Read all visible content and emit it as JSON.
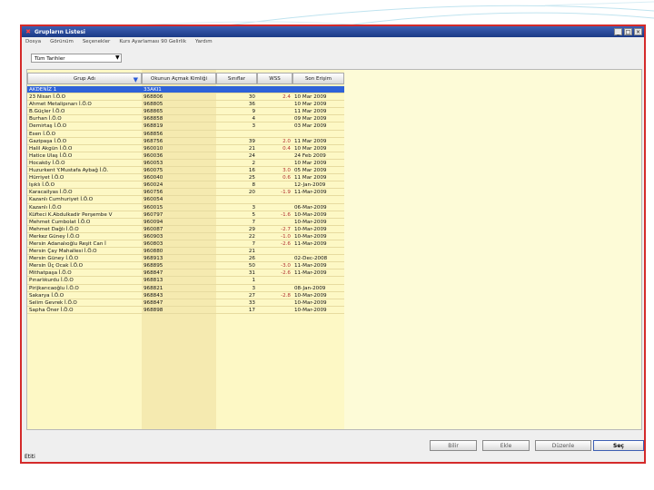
{
  "window": {
    "title": "Grupların Listesi",
    "controls": [
      "_",
      "□",
      "×"
    ]
  },
  "menu": [
    "Dosya",
    "Görünüm",
    "Seçenekler",
    "Kurs Ayarlaması 90 Gelirlik",
    "Yardım"
  ],
  "filter": {
    "value": "Tüm Tarihler",
    "arrow": "▼"
  },
  "table": {
    "headers": [
      "Grup Adı",
      "Okunun Açmak Kimliği",
      "Sınıflar",
      "WSS",
      "Son Erişim"
    ],
    "sort_indicator": "▼",
    "rows": [
      [
        "AKDENİZ 1",
        "33AKI1",
        "",
        "",
        ""
      ],
      [
        "23 Nisan İ.Ö.O",
        "968806",
        "30",
        "2.4",
        "10 Mar 2009"
      ],
      [
        "Ahmet Metalipınarı İ.Ö.O",
        "968805",
        "36",
        "",
        "10 Mar 2009"
      ],
      [
        "B.Güçler İ.Ö.O",
        "968865",
        "9",
        "",
        "11 Mar 2009"
      ],
      [
        "Burhan İ.Ö.O",
        "968858",
        "4",
        "",
        "09 Mar 2009"
      ],
      [
        "Demirtaş İ.Ö.O",
        "968819",
        "3",
        "",
        "03 Mar 2009"
      ],
      [
        "Esen İ.Ö.O",
        "968856",
        "",
        "",
        ""
      ],
      [
        "Gazipaşa İ.Ö.O",
        "968756",
        "39",
        "2.0",
        "11 Mar 2009"
      ],
      [
        "Halil Akgün İ.Ö.O",
        "960010",
        "21",
        "0.4",
        "10 Mar 2009"
      ],
      [
        "Hatice Ulaş İ.Ö.O",
        "960036",
        "24",
        "",
        "24 Feb 2009"
      ],
      [
        "Hocaköy İ.Ö.O",
        "960053",
        "2",
        "",
        "10 Mar 2009"
      ],
      [
        "Huzurkent Y.Mustafa Aybağ İ.Ö.",
        "960075",
        "16",
        "3.0",
        "05 Mar 2009"
      ],
      [
        "Hürriyet İ.Ö.O",
        "960040",
        "25",
        "0.6",
        "11 Mar 2009"
      ],
      [
        "Işıklı İ.Ö.O",
        "960024",
        "8",
        "",
        "12-Jan-2009"
      ],
      [
        "Karacailyas İ.Ö.O",
        "960756",
        "20",
        "-1.9",
        "11-Mar-2009"
      ],
      [
        "Kazanlı Cumhuriyet İ.Ö.O",
        "960054",
        "",
        "",
        ""
      ],
      [
        "Kazanlı İ.Ö.O",
        "960015",
        "3",
        "",
        "06-Mar-2009"
      ],
      [
        "Küfteci K.Abdulkadir Perşembe V",
        "960797",
        "5",
        "-1.6",
        "10-Mar-2009"
      ],
      [
        "Mehmet Cumbolat İ.Ö.O",
        "960094",
        "7",
        "",
        "10-Mar-2009"
      ],
      [
        "Mehmet Dağlı İ.Ö.O",
        "960087",
        "29",
        "-2.7",
        "10-Mar-2009"
      ],
      [
        "Merkez Güney İ.Ö.O",
        "960903",
        "22",
        "-1.0",
        "10-Mar-2009"
      ],
      [
        "Mersin Adanalıoğlu Reşit Can İ",
        "960803",
        "7",
        "-2.6",
        "11-Mar-2009"
      ],
      [
        "Mersin Çay Mahallesi İ.Ö.O",
        "960880",
        "21",
        "",
        ""
      ],
      [
        "Mersin Güney İ.Ö.O",
        "968913",
        "26",
        "",
        "02-Dec-2008"
      ],
      [
        "Mersin Üç Ocak İ.Ö.O",
        "968895",
        "50",
        "-3.0",
        "11-Mar-2009"
      ],
      [
        "Mithatpaşa İ.Ö.O",
        "968847",
        "31",
        "-2.6",
        "11-Mar-2009"
      ],
      [
        "Pınarlıkurdu İ.Ö.O",
        "968813",
        "1",
        "",
        ""
      ],
      [
        "Pirijkarıcaoğlu İ.Ö.O",
        "968821",
        "3",
        "",
        "08-Jan-2009"
      ],
      [
        "Sakarya İ.Ö.O",
        "968843",
        "27",
        "-2.8",
        "10-Mar-2009"
      ],
      [
        "Selim Gevrek İ.Ö.O",
        "968847",
        "33",
        "",
        "10-Mar-2009"
      ],
      [
        "Sapha Öner İ.Ö.O",
        "968898",
        "17",
        "",
        "10-Mar-2009"
      ]
    ]
  },
  "buttons": [
    "Bilir",
    "Ekle",
    "Düzenle",
    "Seç"
  ],
  "status": "Etiti"
}
